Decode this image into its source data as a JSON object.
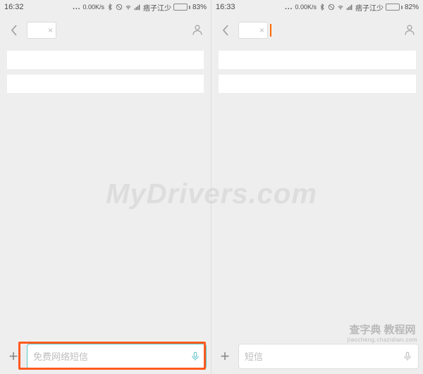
{
  "left": {
    "status": {
      "time": "16:32",
      "dots": "...",
      "speed": "0.00K/s",
      "carrier": "痞子江少",
      "battery_pct": "83%",
      "battery_fill_pct": 83
    },
    "input": {
      "placeholder": "免费网络短信"
    }
  },
  "right": {
    "status": {
      "time": "16:33",
      "dots": "...",
      "speed": "0.00K/s",
      "carrier": "痞子江少",
      "battery_pct": "82%",
      "battery_fill_pct": 82
    },
    "input": {
      "placeholder": "短信"
    }
  },
  "icons": {
    "plus": "+",
    "clear": "×"
  },
  "watermarks": {
    "main": "MyDrivers.com",
    "corner_top": "查字典 教程网",
    "corner_bottom": "jiaocheng.chazidian.com"
  }
}
